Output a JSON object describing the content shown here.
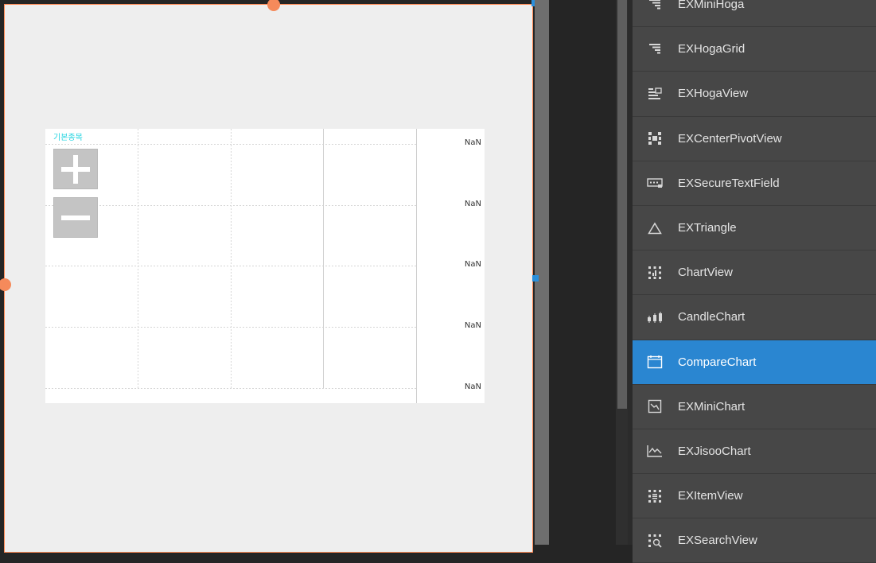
{
  "chart": {
    "title": "기본종목",
    "y_labels": [
      "NaN",
      "NaN",
      "NaN",
      "NaN",
      "NaN"
    ],
    "zoom_in_icon": "plus-icon",
    "zoom_out_icon": "minus-icon"
  },
  "palette": {
    "items": [
      {
        "label": "EXMiniHoga",
        "icon": "hoga-icon",
        "selected": false
      },
      {
        "label": "EXHogaGrid",
        "icon": "hoga-grid-icon",
        "selected": false
      },
      {
        "label": "EXHogaView",
        "icon": "hoga-view-icon",
        "selected": false
      },
      {
        "label": "EXCenterPivotView",
        "icon": "pivot-view-icon",
        "selected": false
      },
      {
        "label": "EXSecureTextField",
        "icon": "secure-field-icon",
        "selected": false
      },
      {
        "label": "EXTriangle",
        "icon": "triangle-icon",
        "selected": false
      },
      {
        "label": "ChartView",
        "icon": "chart-view-icon",
        "selected": false
      },
      {
        "label": "CandleChart",
        "icon": "candle-chart-icon",
        "selected": false
      },
      {
        "label": "CompareChart",
        "icon": "compare-chart-icon",
        "selected": true
      },
      {
        "label": "EXMiniChart",
        "icon": "mini-chart-icon",
        "selected": false
      },
      {
        "label": "EXJisooChart",
        "icon": "line-chart-icon",
        "selected": false
      },
      {
        "label": "EXItemView",
        "icon": "item-view-icon",
        "selected": false
      },
      {
        "label": "EXSearchView",
        "icon": "search-view-icon",
        "selected": false
      }
    ]
  },
  "colors": {
    "selected": "#2a86d1",
    "item_bg": "#474747",
    "title_accent": "#22d4e0",
    "selection_handle": "#f58a5b"
  }
}
